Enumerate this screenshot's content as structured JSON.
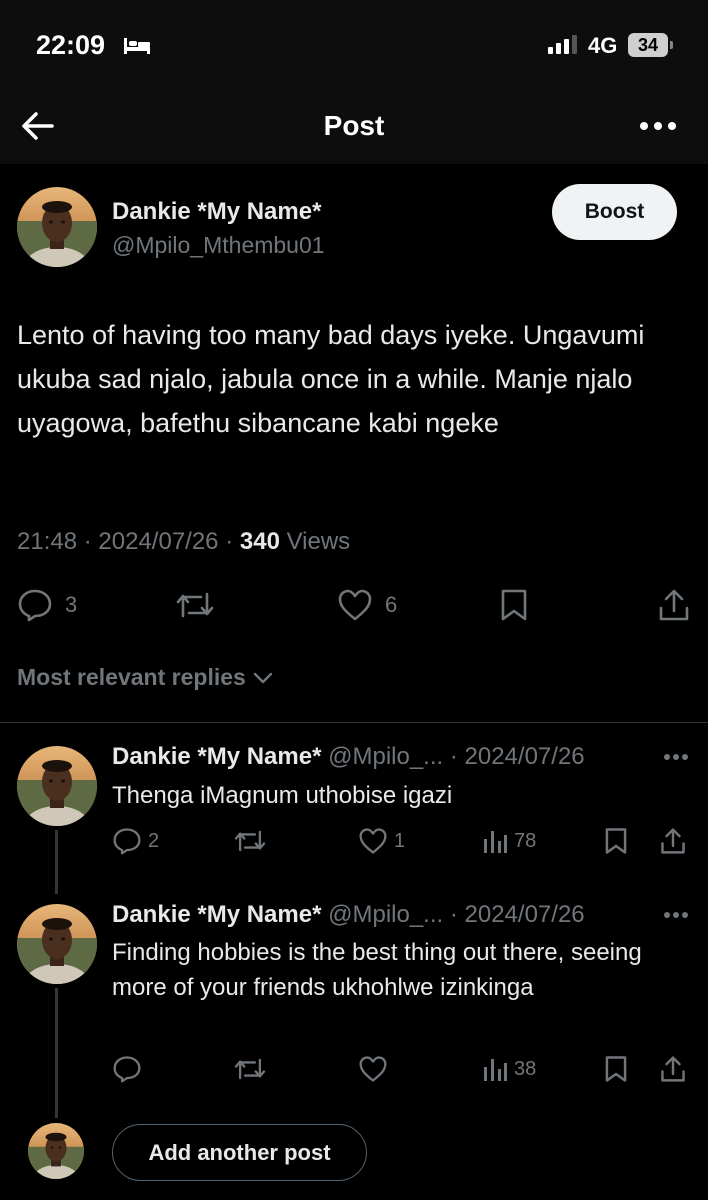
{
  "status_bar": {
    "time": "22:09",
    "network": "4G",
    "battery": "34"
  },
  "nav": {
    "title": "Post"
  },
  "post": {
    "author_name": "Dankie *My Name*",
    "author_handle": "@Mpilo_Mthembu01",
    "boost_label": "Boost",
    "text": "Lento of having too many bad days iyeke. Ungavumi ukuba sad njalo, jabula once in a while. Manje njalo uyagowa, bafethu sibancane kabi ngeke",
    "time": "21:48",
    "date": "2024/07/26",
    "views_count": "340",
    "views_label": "Views",
    "replies": "3",
    "likes": "6"
  },
  "replies_filter": "Most relevant replies",
  "replies": [
    {
      "name": "Dankie *My Name*",
      "handle": "@Mpilo_...",
      "date": "2024/07/26",
      "text": "Thenga iMagnum uthobise igazi",
      "replies": "2",
      "likes": "1",
      "views": "78"
    },
    {
      "name": "Dankie *My Name*",
      "handle": "@Mpilo_...",
      "date": "2024/07/26",
      "text": "Finding hobbies is the best thing out there, seeing more of your friends ukhohlwe izinkinga",
      "views": "38"
    }
  ],
  "add_post_label": "Add another post",
  "colors": {
    "background": "#000000",
    "text": "#e7e9ea",
    "muted": "#71767b",
    "button_bg": "#eff3f4"
  }
}
